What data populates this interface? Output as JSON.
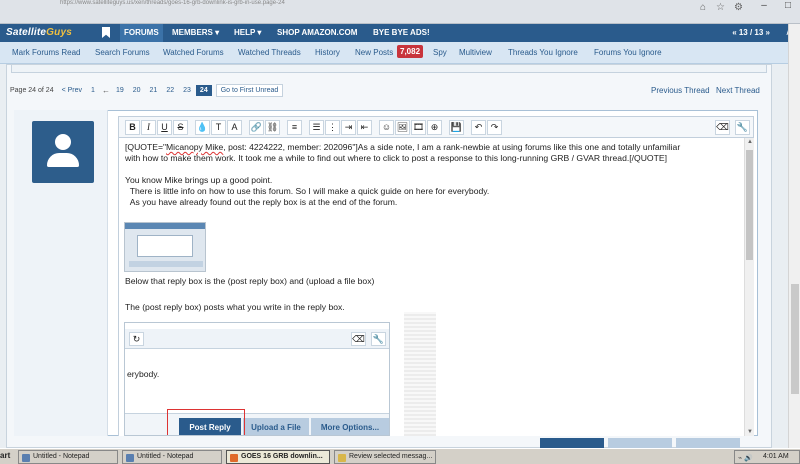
{
  "browser": {
    "url_fragment": "https://www.satelliteguys.us/xen/threads/goes-16-grb-downlink-is-grb-in-use.page-24",
    "tab_count": "3"
  },
  "site": {
    "logo_part1": "Satellite",
    "logo_part2": "Guys",
    "nav": {
      "forums": "FORUMS",
      "members": "MEMBERS ▾",
      "help": "HELP ▾",
      "shop": "SHOP AMAZON.COM",
      "ads": "BYE BYE ADS!",
      "pager": "« 13 / 13 »"
    },
    "subnav": {
      "mark_read": "Mark Forums Read",
      "search": "Search Forums",
      "watched_forums": "Watched Forums",
      "watched_threads": "Watched Threads",
      "history": "History",
      "new_posts": "New Posts",
      "new_posts_count": "7,082",
      "spy": "Spy",
      "multiview": "Multiview",
      "threads_ignore": "Threads You Ignore",
      "forums_ignore": "Forums You Ignore"
    }
  },
  "pagination": {
    "label": "Page 24 of 24",
    "prev": "< Prev",
    "pages": [
      "1",
      "19",
      "20",
      "21",
      "22",
      "23",
      "24"
    ],
    "ellipsis": "←",
    "current": "24",
    "first_unread": "Go to First Unread",
    "previous_thread": "Previous Thread",
    "next_thread": "Next Thread"
  },
  "editor": {
    "toolbar": [
      "B",
      "I",
      "U",
      "S",
      "💧",
      "T",
      "A",
      "🔗",
      "⛓",
      "≡",
      "☰",
      "⋮",
      "⇥",
      "⇤",
      "☺",
      "🖼",
      "🎞",
      "⊕",
      "💾",
      "↶",
      "↷",
      "⌫",
      "🔧"
    ],
    "quote_line1_pre": "[QUOTE=\"",
    "quote_user": "Micanopy Mike",
    "quote_line1_post": ", post: 4224222, member: 202096\"]As a side note, I am a rank-newbie at using forums like this one and totally unfamiliar",
    "quote_line2": "with how to make them work. It took me a while to find out where to click to post a response to this long-running GRB / GVAR thread.[/QUOTE]",
    "paragraph1": "You know Mike brings up a good point.",
    "paragraph2": "  There is little info on how to use this forum. So I will make a quick guide on here for everybody.",
    "paragraph3": "  As you have already found out the reply box is at the end of the forum.",
    "below_text": "Below that reply box is the (post reply box) and (upload a file box)",
    "post_text": "The (post reply box) posts what you write in the reply box.",
    "embed_text": "erybody.",
    "embed_post_reply": "Post Reply",
    "embed_upload": "Upload a File",
    "embed_more": "More Options..."
  },
  "taskbar": {
    "start": "art",
    "items": [
      "Untitled - Notepad",
      "Untitled - Notepad",
      "GOES 16 GRB downlin...",
      "Review selected messag..."
    ],
    "clock": "4:01 AM"
  },
  "colors": {
    "nav_bg": "#2a5b8c",
    "subnav_bg": "#d8e6f3",
    "badge": "#c8343c"
  }
}
